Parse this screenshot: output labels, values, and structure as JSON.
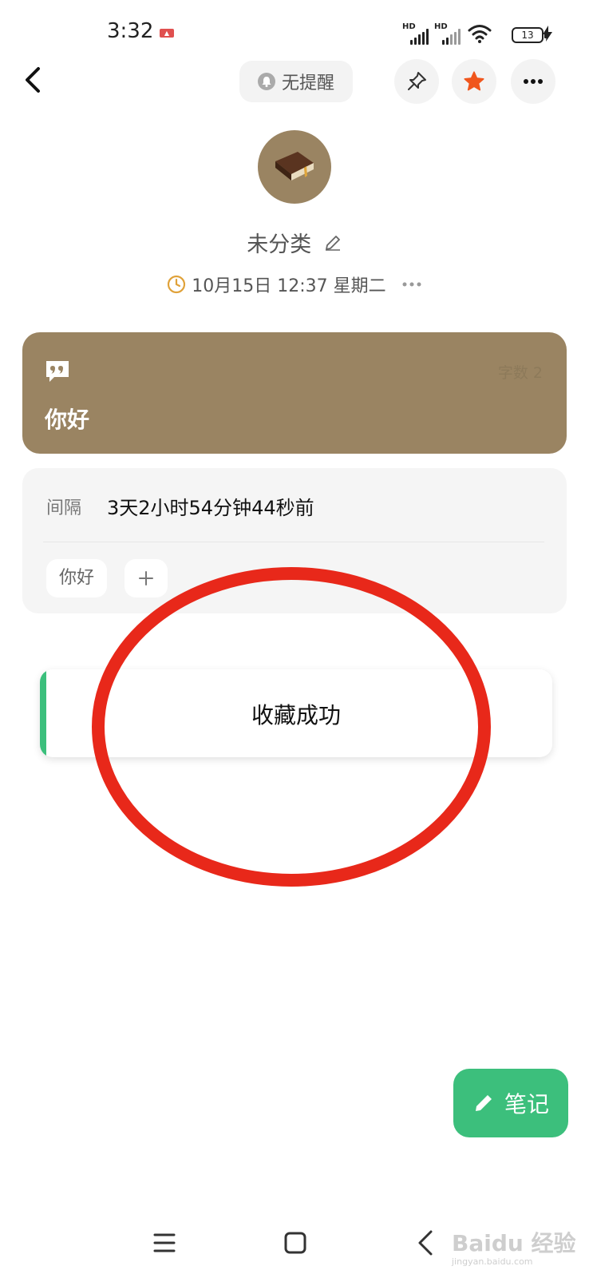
{
  "status_bar": {
    "time": "3:32",
    "battery": "13",
    "network": [
      "HD",
      "HD"
    ]
  },
  "header": {
    "reminder_label": "无提醒"
  },
  "note": {
    "category": "未分类",
    "datetime": "10月15日 12:37 星期二",
    "text": "你好",
    "word_count_label": "字数 2"
  },
  "info": {
    "interval_label": "间隔",
    "interval_value": "3天2小时54分钟44秒前",
    "tags": [
      "你好"
    ]
  },
  "toast": {
    "message": "收藏成功"
  },
  "fab": {
    "label": "笔记"
  },
  "watermark": {
    "text": "Baidu 经验",
    "sub": "jingyan.baidu.com"
  },
  "colors": {
    "accent_green": "#3cbf7c",
    "card_brown": "#9a8462",
    "star_orange": "#f0561d",
    "annotation_red": "#e8281a"
  }
}
